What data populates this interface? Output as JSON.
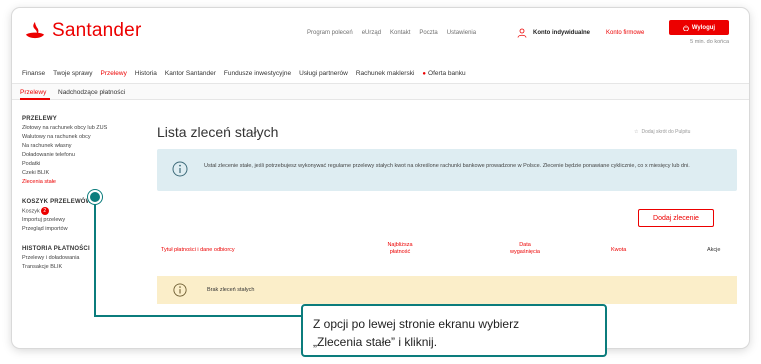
{
  "header": {
    "brand": "Santander",
    "top_links": [
      "Program poleceń",
      "eUrząd",
      "Kontakt",
      "Poczta",
      "Ustawienia"
    ],
    "account_individual": "Konto indywidualne",
    "account_company": "Konto firmowe",
    "logout_label": "Wyloguj",
    "session_timer": "5 min. do końca"
  },
  "main_nav": {
    "items": [
      "Finanse",
      "Twoje sprawy",
      "Przelewy",
      "Historia",
      "Kantor Santander",
      "Fundusze inwestycyjne",
      "Usługi partnerów",
      "Rachunek maklerski",
      "Oferta banku"
    ],
    "active_index": 2
  },
  "sub_nav": {
    "tabs": [
      "Przelewy",
      "Nadchodzące płatności"
    ],
    "active_index": 0
  },
  "sidebar": {
    "section1": {
      "title": "PRZELEWY",
      "items": [
        "Złotowy na rachunek obcy lub ZUS",
        "Walutowy na rachunek obcy",
        "Na rachunek własny",
        "Doładowanie telefonu",
        "Podatki",
        "Czeki BLIK",
        "Zlecenia stałe"
      ]
    },
    "section2": {
      "title": "KOSZYK PRZELEWÓW",
      "items": [
        "Koszyk",
        "Importuj przelewy",
        "Przegląd importów"
      ],
      "basket_count": "2"
    },
    "section3": {
      "title": "HISTORIA PŁATNOŚCI",
      "items": [
        "Przelewy i doładowania",
        "Transakcje BLIK"
      ]
    }
  },
  "content": {
    "title": "Lista zleceń stałych",
    "shortcut": "Dodaj skrót do Pulpitu",
    "info_text": "Ustal zlecenie stałe, jeśli potrzebujesz wykonywać regularne przelewy stałych kwot na określone rachunki bankowe prowadzone w Polsce. Zlecenie będzie ponawiane cyklicznie, co x miesięcy lub dni.",
    "add_button": "Dodaj zlecenie",
    "columns": {
      "title": "Tytuł płatności i dane odbiorcy",
      "next_l1": "Najbliższa",
      "next_l2": "płatność",
      "expiry_l1": "Data",
      "expiry_l2": "wygaśnięcia",
      "amount": "Kwota",
      "actions": "Akcje"
    },
    "empty_text": "Brak zleceń stałych"
  },
  "tutorial": {
    "callout_line1": "Z opcji po lewej stronie ekranu wybierz",
    "callout_line2": "„Zlecenia stałe” i kliknij."
  },
  "colors": {
    "brand_red": "#ec0000",
    "info_bg": "#deedf2",
    "empty_bg": "#fbeec9",
    "tutorial_teal": "#0b7c7c"
  }
}
